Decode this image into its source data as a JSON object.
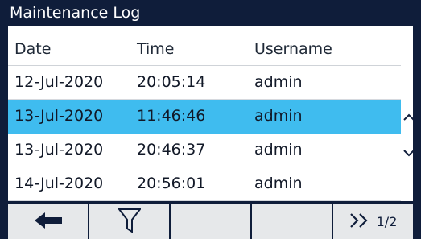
{
  "title": "Maintenance Log",
  "columns": {
    "date": "Date",
    "time": "Time",
    "username": "Username"
  },
  "rows": [
    {
      "date": "12-Jul-2020",
      "time": "20:05:14",
      "username": "admin"
    },
    {
      "date": "13-Jul-2020",
      "time": "11:46:46",
      "username": "admin",
      "selected": true
    },
    {
      "date": "13-Jul-2020",
      "time": "20:46:37",
      "username": "admin"
    },
    {
      "date": "14-Jul-2020",
      "time": "20:56:01",
      "username": "admin"
    }
  ],
  "softkeys": {
    "back_icon": "arrow-left-icon",
    "filter_icon": "filter-icon",
    "next_icon": "double-chevron-right-icon",
    "page_indicator": "1/2"
  },
  "scroll": {
    "up_icon": "chevron-up-icon",
    "down_icon": "chevron-down-icon"
  },
  "colors": {
    "frame": "#0f1d3a",
    "selected_row": "#3fbcef",
    "softkey_bg": "#e6e8ea"
  }
}
